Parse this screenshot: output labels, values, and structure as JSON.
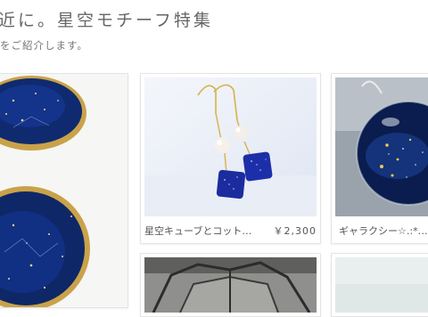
{
  "header": {
    "title": "近に。星空モチーフ特集",
    "subtitle": "をご紹介します。"
  },
  "products": [
    {
      "name": "",
      "price": "",
      "image": "blue-star-dish-photo"
    },
    {
      "name": "星空キューブとコット…",
      "price": "￥2,300",
      "image": "blue-cube-earrings-photo"
    },
    {
      "name": "ギャラクシー☆.:*…",
      "price": "",
      "image": "galaxy-glass-pendant-photo"
    },
    {
      "name": "",
      "price": "",
      "image": "stained-glass-item-photo"
    },
    {
      "name": "",
      "price": "",
      "image": "product-photo"
    }
  ]
}
